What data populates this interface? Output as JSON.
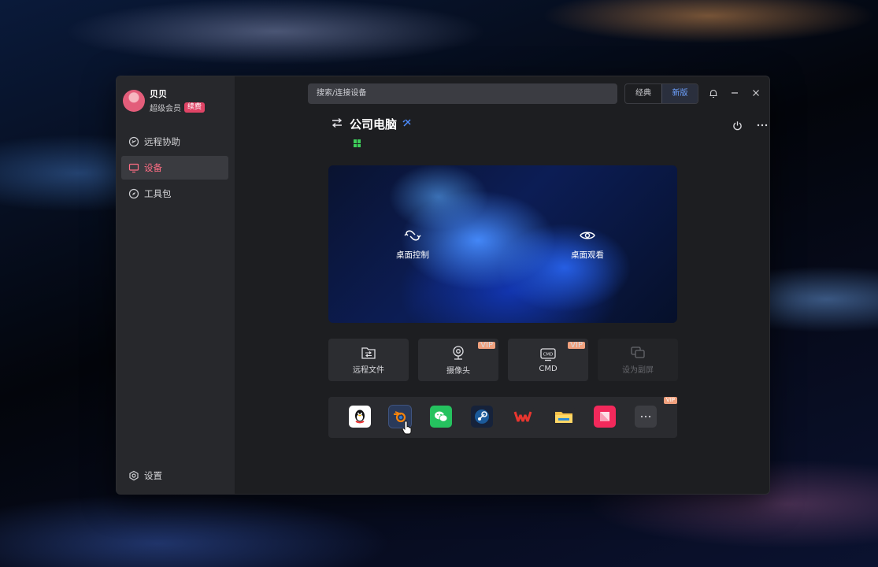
{
  "user": {
    "name": "贝贝",
    "membership": "超级会员",
    "renew": "续费"
  },
  "nav": [
    {
      "label": "远程协助",
      "icon": "remote-assist-icon"
    },
    {
      "label": "设备",
      "icon": "monitor-icon",
      "active": true
    },
    {
      "label": "工具包",
      "icon": "compass-icon"
    }
  ],
  "settings_label": "设置",
  "search": {
    "placeholder": "搜索/连接设备"
  },
  "version_switch": {
    "classic": "经典",
    "new": "新版",
    "selected": "新版"
  },
  "device": {
    "name": "公司电脑",
    "os": "windows"
  },
  "preview_actions": {
    "control": "桌面控制",
    "watch": "桌面观看"
  },
  "tools": [
    {
      "label": "远程文件",
      "icon": "folder-transfer-icon",
      "vip": ""
    },
    {
      "label": "摄像头",
      "icon": "camera-icon",
      "vip": "VIP"
    },
    {
      "label": "CMD",
      "icon": "cmd-icon",
      "vip": "VIP"
    },
    {
      "label": "设为副屏",
      "icon": "extend-screen-icon",
      "vip": "",
      "disabled": true
    }
  ],
  "apps_vip": "VIP",
  "apps": [
    "qq",
    "blender",
    "wechat",
    "steam",
    "wps",
    "file-explorer",
    "netease-app",
    "more"
  ],
  "colors": {
    "accent": "#ff6d84",
    "blue": "#6ea2ff",
    "window_bg": "#1d1e21",
    "sidebar_bg": "#27282c"
  }
}
